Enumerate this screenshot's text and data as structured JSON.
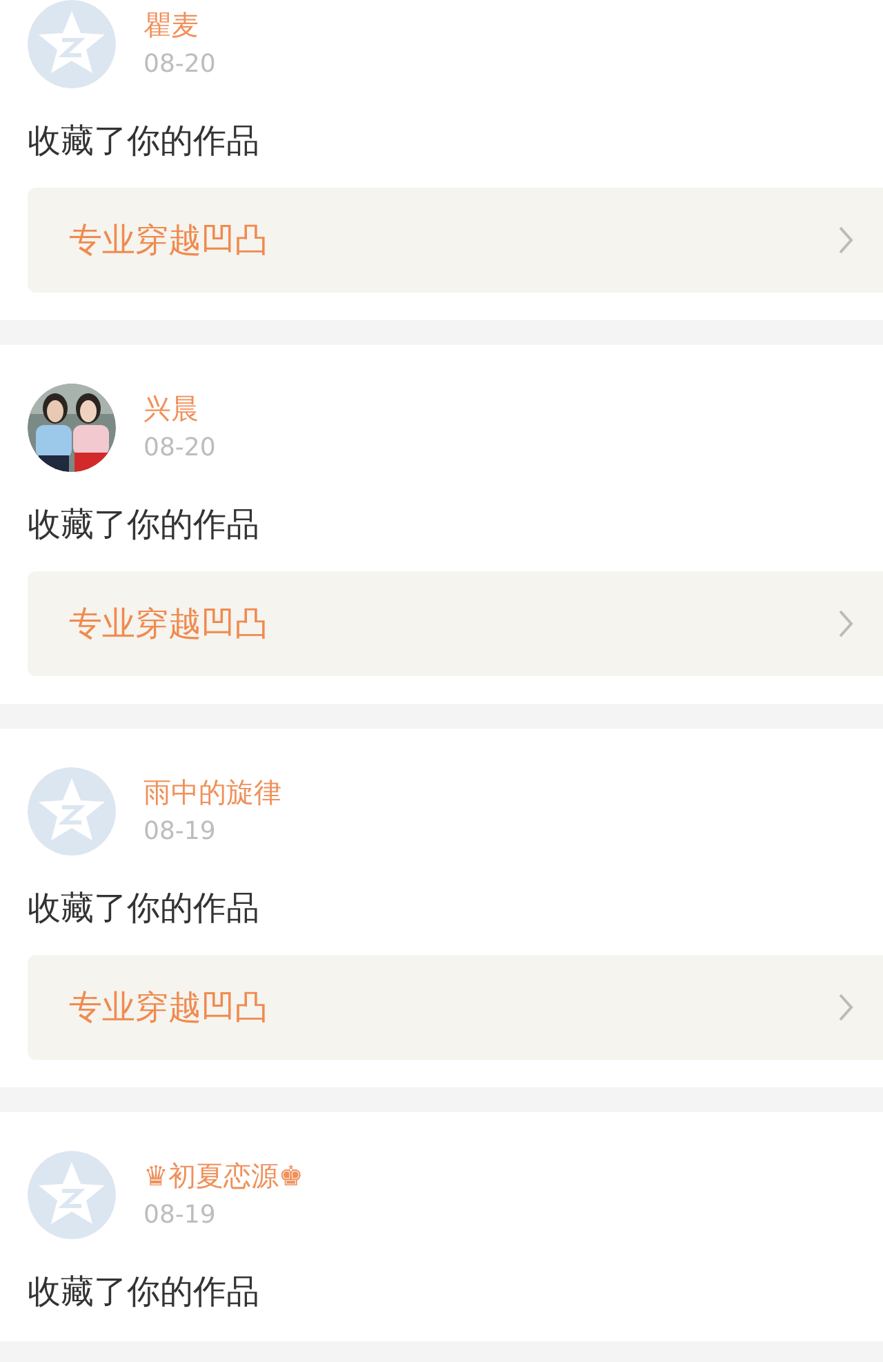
{
  "notifications": [
    {
      "avatar": {
        "kind": "default"
      },
      "name": "瞿麦",
      "date": "08-20",
      "message": "收藏了你的作品",
      "link": "专业穿越凹凸"
    },
    {
      "name": "兴晨",
      "date": "08-20",
      "message": "收藏了你的作品",
      "link": "专业穿越凹凸"
    },
    {
      "avatar": {
        "kind": "default"
      },
      "name": "雨中的旋律",
      "date": "08-19",
      "message": "收藏了你的作品",
      "link": "专业穿越凹凸"
    },
    {
      "avatar": {
        "kind": "default"
      },
      "name": "♛初夏恋源♚",
      "date": "08-19",
      "message": "收藏了你的作品"
    }
  ]
}
